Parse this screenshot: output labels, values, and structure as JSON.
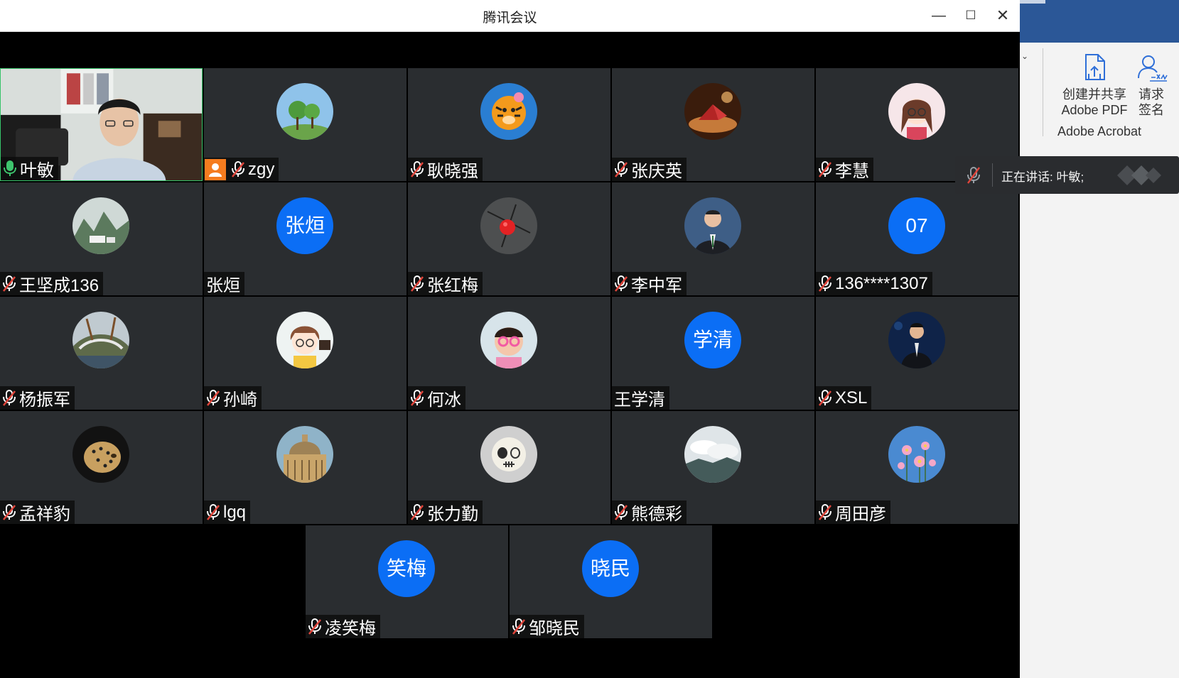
{
  "window": {
    "title": "腾讯会议"
  },
  "participants": [
    {
      "name": "叶敏",
      "mic": "on",
      "avatar": "video"
    },
    {
      "name": "zgy",
      "mic": "muted",
      "avatar": "tree",
      "badge": "person-icon"
    },
    {
      "name": "耿晓强",
      "mic": "muted",
      "avatar": "tiger"
    },
    {
      "name": "张庆英",
      "mic": "muted",
      "avatar": "origami"
    },
    {
      "name": "李慧",
      "mic": "muted",
      "avatar": "girl"
    },
    {
      "name": "王坚成136",
      "mic": "muted",
      "avatar": "mountain"
    },
    {
      "name": "张烜",
      "mic": "none",
      "avatar": "initials",
      "initials": "张烜"
    },
    {
      "name": "张红梅",
      "mic": "muted",
      "avatar": "flower-red"
    },
    {
      "name": "李中军",
      "mic": "muted",
      "avatar": "man-suit"
    },
    {
      "name": "136****1307",
      "mic": "muted",
      "avatar": "initials",
      "initials": "07"
    },
    {
      "name": "杨振军",
      "mic": "muted",
      "avatar": "bridge"
    },
    {
      "name": "孙崎",
      "mic": "muted",
      "avatar": "anime-boy"
    },
    {
      "name": "何冰",
      "mic": "muted",
      "avatar": "child"
    },
    {
      "name": "王学清",
      "mic": "none",
      "avatar": "initials",
      "initials": "学清"
    },
    {
      "name": "XSL",
      "mic": "muted",
      "avatar": "man-suit2"
    },
    {
      "name": "孟祥豹",
      "mic": "muted",
      "avatar": "leopard"
    },
    {
      "name": "lgq",
      "mic": "muted",
      "avatar": "dome"
    },
    {
      "name": "张力勤",
      "mic": "muted",
      "avatar": "skull"
    },
    {
      "name": "熊德彩",
      "mic": "muted",
      "avatar": "clouds"
    },
    {
      "name": "周田彦",
      "mic": "muted",
      "avatar": "cosmos"
    },
    {
      "name": "凌笑梅",
      "mic": "muted",
      "avatar": "initials",
      "initials": "笑梅"
    },
    {
      "name": "邹晓民",
      "mic": "muted",
      "avatar": "initials",
      "initials": "晓民"
    }
  ],
  "ribbon": {
    "share_pdf_line1": "创建并共享",
    "share_pdf_line2": "Adobe PDF",
    "sign_line1": "请求",
    "sign_line2": "签名",
    "group_label": "Adobe Acrobat"
  },
  "toast": {
    "text": "正在讲话: 叶敏;"
  },
  "colors": {
    "initials_bg": "#0b6ef5",
    "tile_bg": "#2a2d30",
    "mic_muted": "#e0453b",
    "mic_on": "#3ec46d",
    "badge": "#f57c1f"
  }
}
